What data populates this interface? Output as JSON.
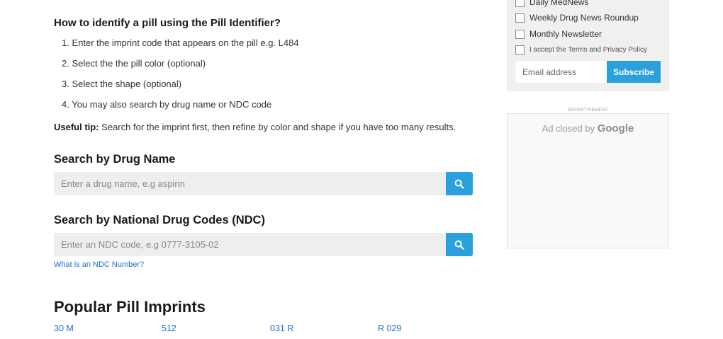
{
  "howto": {
    "title": "How to identify a pill using the Pill Identifier?",
    "steps": [
      "1. Enter the imprint code that appears on the pill e.g. L484",
      "2. Select the the pill color (optional)",
      "3. Select the shape (optional)",
      "4. You may also search by drug name or NDC code"
    ],
    "tip_label": "Useful tip:",
    "tip_text": " Search for the imprint first, then refine by color and shape if you have too many results."
  },
  "drug_search": {
    "title": "Search by Drug Name",
    "placeholder": "Enter a drug name, e.g aspirin"
  },
  "ndc_search": {
    "title": "Search by National Drug Codes (NDC)",
    "placeholder": "Enter an NDC code, e.g 0777-3105-02",
    "help_link": "What is an NDC Number?"
  },
  "popular": {
    "title": "Popular Pill Imprints",
    "imprints": [
      "30 M",
      "512",
      "031 R",
      "R 029"
    ]
  },
  "newsletter": {
    "options": [
      "Daily MedNews",
      "Weekly Drug News Roundup",
      "Monthly Newsletter"
    ],
    "terms": "I accept the Terms and Privacy Policy",
    "email_placeholder": "Email address",
    "subscribe_label": "Subscribe"
  },
  "ad": {
    "label": "ADVERTISEMENT",
    "closed_text": "Ad closed by ",
    "brand": "Google"
  },
  "colors": {
    "accent": "#2aa0dd",
    "link": "#1c6fcc",
    "panel_bg": "#f0f0f0",
    "input_bg": "#eeeeee"
  }
}
